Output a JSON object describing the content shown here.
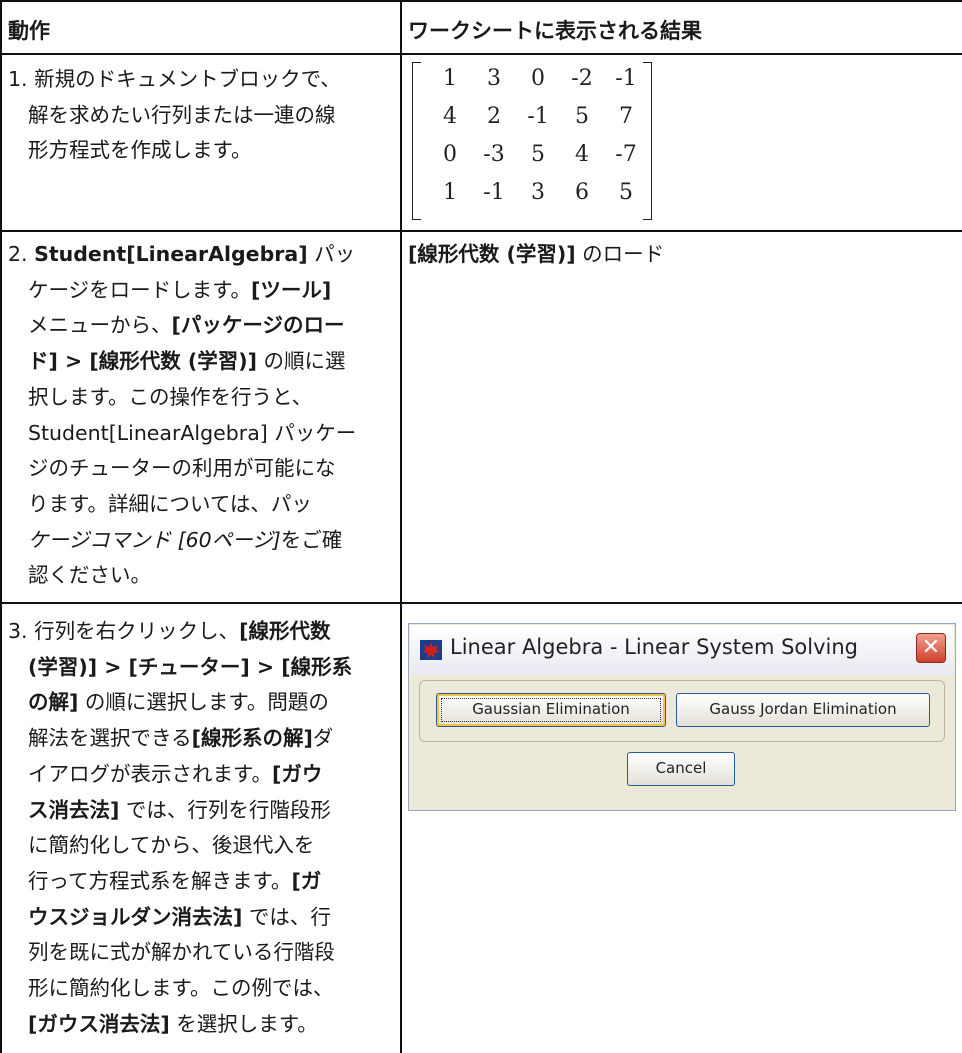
{
  "headers": {
    "action": "動作",
    "result": "ワークシートに表示される結果"
  },
  "row1": {
    "lines": [
      "1. 新規のドキュメントブロックで、",
      "解を求めたい行列または一連の線",
      "形方程式を作成します。"
    ],
    "matrix": [
      [
        "1",
        "3",
        "0",
        "-2",
        "-1"
      ],
      [
        "4",
        "2",
        "-1",
        "5",
        "7"
      ],
      [
        "0",
        "-3",
        "5",
        "4",
        "-7"
      ],
      [
        "1",
        "-1",
        "3",
        "6",
        "5"
      ]
    ]
  },
  "row2": {
    "line1_pre": "2. ",
    "line1_bold": "Student[LinearAlgebra]",
    "line1_post": " パッ",
    "line2_pre": "ケージをロードします。",
    "line2_bold": "[ツール]",
    "line3_pre": "メニューから、",
    "line3_bold": "[パッケージのロー",
    "line4_bold": "ド] > [線形代数 (学習)]",
    "line4_post": " の順に選",
    "line5": "択します。この操作を行うと、",
    "line6": "Student[LinearAlgebra] パッケー",
    "line7": "ジのチューターの利用が可能にな",
    "line8": "ります。詳細については、パッ",
    "line9_italic": "ケージコマンド [60ページ]",
    "line9_post": "をご確",
    "line10": "認ください。",
    "result_bold": "[線形代数 (学習)]",
    "result_post": " のロード"
  },
  "row3": {
    "line1_pre": "3. 行列を右クリックし、",
    "line1_bold": "[線形代数",
    "line2_bold": "(学習)] > [チューター] > [線形系",
    "line3_bold": "の解]",
    "line3_post": " の順に選択します。問題の",
    "line4_pre": "解法を選択できる",
    "line4_bold": "[線形系の解]",
    "line4_post": "ダ",
    "line5_pre": "イアログが表示されます。",
    "line5_bold": "[ガウ",
    "line6_bold": "ス消去法]",
    "line6_post": " では、行列を行階段形",
    "line7": "に簡約化してから、後退代入を",
    "line8_pre": "行って方程式系を解きます。",
    "line8_bold": "[ガ",
    "line9_bold": "ウスジョルダン消去法]",
    "line9_post": " では、行",
    "line10": "列を既に式が解かれている行階段",
    "line11": "形に簡約化します。この例では、",
    "line12_bold": "[ガウス消去法]",
    "line12_post": " を選択します。"
  },
  "dialog": {
    "title": "Linear Algebra - Linear System Solving",
    "close_glyph": "✕",
    "buttons": {
      "gaussian": "Gaussian Elimination",
      "gauss_jordan": "Gauss Jordan Elimination",
      "cancel": "Cancel"
    }
  }
}
